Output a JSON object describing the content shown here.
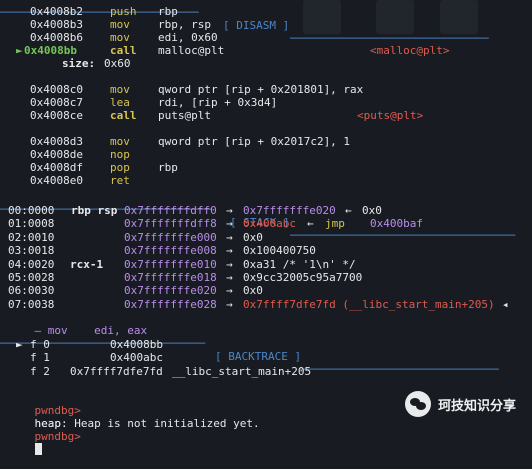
{
  "disasm": {
    "header": "[ DISASM ]",
    "lines": [
      {
        "addr": "0x4008b2",
        "mnem": "push",
        "ops": "rbp"
      },
      {
        "addr": "0x4008b3",
        "mnem": "mov",
        "ops": "rbp, rsp"
      },
      {
        "addr": "0x4008b6",
        "mnem": "mov",
        "ops": "edi, 0x60"
      },
      {
        "marker": "►",
        "addr": "0x4008bb",
        "mnem": "call",
        "ops": "malloc@plt",
        "comment": "<malloc@plt>"
      },
      {
        "sublabel": "size:",
        "subvalue": "0x60"
      },
      {
        "addr": "0x4008c0",
        "mnem": "mov",
        "ops": "qword ptr [rip + 0x201801], rax"
      },
      {
        "addr": "0x4008c7",
        "mnem": "lea",
        "ops": "rdi, [rip + 0x3d4]"
      },
      {
        "addr": "0x4008ce",
        "mnem": "call",
        "ops": "puts@plt",
        "comment": "<puts@plt>"
      },
      {
        "addr": "0x4008d3",
        "mnem": "mov",
        "ops": "qword ptr [rip + 0x2017c2], 1"
      },
      {
        "addr": "0x4008de",
        "mnem": "nop",
        "ops": ""
      },
      {
        "addr": "0x4008df",
        "mnem": "pop",
        "ops": "rbp"
      },
      {
        "addr": "0x4008e0",
        "mnem": "ret",
        "ops": ""
      }
    ]
  },
  "stack": {
    "header": "[ STACK ]",
    "rows": [
      {
        "off": "00:0000",
        "reg": "rbp rsp",
        "addr": "0x7fffffffdff0",
        "chain": "0x7fffffffe020",
        "tail": "0x0"
      },
      {
        "off": "01:0008",
        "reg": "",
        "addr": "0x7fffffffdff8",
        "chain": "0x400abc",
        "tail": "jmp",
        "tail2": "0x400baf"
      },
      {
        "off": "02:0010",
        "reg": "",
        "addr": "0x7fffffffe000",
        "value": "0x0"
      },
      {
        "off": "03:0018",
        "reg": "",
        "addr": "0x7fffffffe008",
        "value": "0x100400750"
      },
      {
        "off": "04:0020",
        "reg": "rcx-1",
        "addr": "0x7fffffffe010",
        "value": "0xa31 /* '1\\n' */"
      },
      {
        "off": "05:0028",
        "reg": "",
        "addr": "0x7fffffffe018",
        "value": "0x9cc32005c95a7700"
      },
      {
        "off": "06:0030",
        "reg": "",
        "addr": "0x7fffffffe020",
        "value": "0x0"
      },
      {
        "off": "07:0038",
        "reg": "",
        "addr": "0x7fffffffe028",
        "chain": "0x7ffff7dfe7fd (__libc_start_main+205)"
      }
    ],
    "overflow": "— mov    edi, eax"
  },
  "backtrace": {
    "header": "[ BACKTRACE ]",
    "frames": [
      {
        "marker": "►",
        "label": "f 0",
        "addr": "0x4008bb",
        "sym": ""
      },
      {
        "marker": "",
        "label": "f 1",
        "addr": "0x400abc",
        "sym": ""
      },
      {
        "marker": "",
        "label": "f 2",
        "addr": "0x7ffff7dfe7fd",
        "sym": "__libc_start_main+205"
      }
    ]
  },
  "console": {
    "prompt": "pwndbg>",
    "command": "heap",
    "output": "heap: Heap is not initialized yet.",
    "prompt2": "pwndbg>"
  },
  "watermark": {
    "text": "珂技知识分享"
  }
}
